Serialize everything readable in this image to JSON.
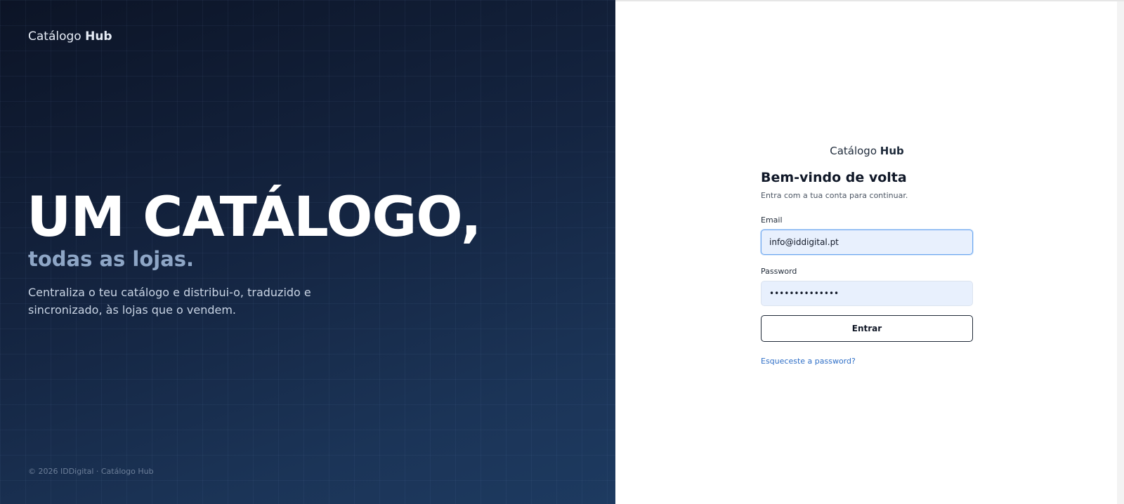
{
  "brand": {
    "name_regular": "Catálogo",
    "name_bold": "Hub"
  },
  "hero": {
    "headline": "UM CATÁLOGO,",
    "subheadline": "todas as lojas.",
    "description": "Centraliza o teu catálogo e distribui-o, traduzido e sincronizado, às lojas que o vendem.",
    "footer": "© 2026 IDDigital · Catálogo Hub"
  },
  "login": {
    "title": "Bem-vindo de volta",
    "subtitle": "Entra com a tua conta para continuar.",
    "email": {
      "label": "Email",
      "value": "info@iddigital.pt"
    },
    "password": {
      "label": "Password",
      "value": "••••••••••••••"
    },
    "submit_label": "Entrar",
    "forgot_label": "Esqueceste a password?"
  },
  "colors": {
    "hero_background": "#142440",
    "accent_link": "#2f6fc7",
    "input_background": "#e8f0fd",
    "focus_border": "#6ea8f0"
  }
}
